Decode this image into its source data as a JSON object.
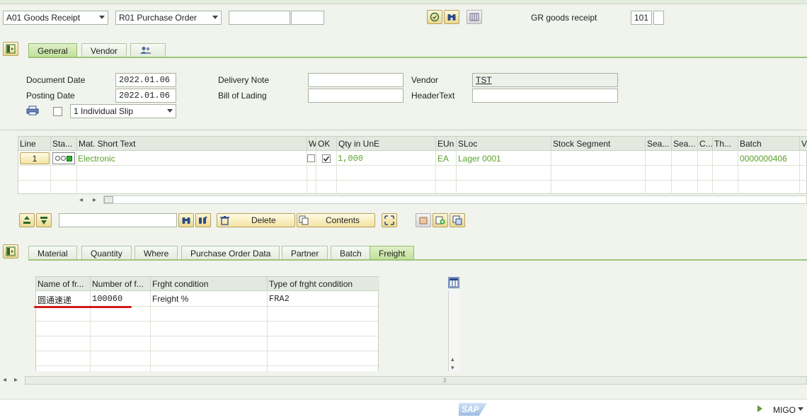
{
  "header": {
    "action_value": "A01 Goods Receipt",
    "reference_value": "R01 Purchase Order",
    "doc_input_1": "",
    "doc_input_2": "",
    "movement_label": "GR goods receipt",
    "movement_type": "101",
    "movement_type_2": ""
  },
  "header_tabs": [
    {
      "label": "General"
    },
    {
      "label": "Vendor"
    }
  ],
  "general": {
    "document_date_label": "Document Date",
    "document_date": "2022.01.06",
    "posting_date_label": "Posting Date",
    "posting_date": "2022.01.06",
    "slip_value": "1 Individual Slip",
    "delivery_note_label": "Delivery Note",
    "delivery_note": "",
    "bill_of_lading_label": "Bill of Lading",
    "bill_of_lading": "",
    "vendor_label": "Vendor",
    "vendor_value": "TST",
    "header_text_label": "HeaderText",
    "header_text": ""
  },
  "items_table": {
    "columns": [
      "Line",
      "Sta...",
      "Mat. Short Text",
      "W",
      "OK",
      "Qty in UnE",
      "EUn",
      "SLoc",
      "Stock Segment",
      "Sea...",
      "Sea...",
      "C...",
      "Th...",
      "Batch",
      "V"
    ],
    "rows": [
      {
        "line": "1",
        "text": "Electronic",
        "qty": "1,000",
        "eun": "EA",
        "sloc": "Lager 0001",
        "batch": "0000000406"
      }
    ]
  },
  "toolbar2": {
    "search_value": "",
    "delete_label": "Delete",
    "contents_label": "Contents"
  },
  "detail_tabs": [
    {
      "label": "Material"
    },
    {
      "label": "Quantity"
    },
    {
      "label": "Where"
    },
    {
      "label": "Purchase Order Data"
    },
    {
      "label": "Partner"
    },
    {
      "label": "Batch"
    },
    {
      "label": "Freight"
    }
  ],
  "freight_table": {
    "columns": [
      "Name of fr...",
      "Number of f...",
      "Frght condition",
      "Type of frght condition"
    ],
    "rows": [
      {
        "name": "圆通速递",
        "number": "100060",
        "condition": "Freight %",
        "type": "FRA2"
      }
    ]
  },
  "status": {
    "logo": "SAP",
    "tcode": "MIGO"
  },
  "colors": {
    "accent_green": "#5aa02c",
    "tab_active": "#bfe098",
    "highlight_red": "#d11a1a"
  }
}
